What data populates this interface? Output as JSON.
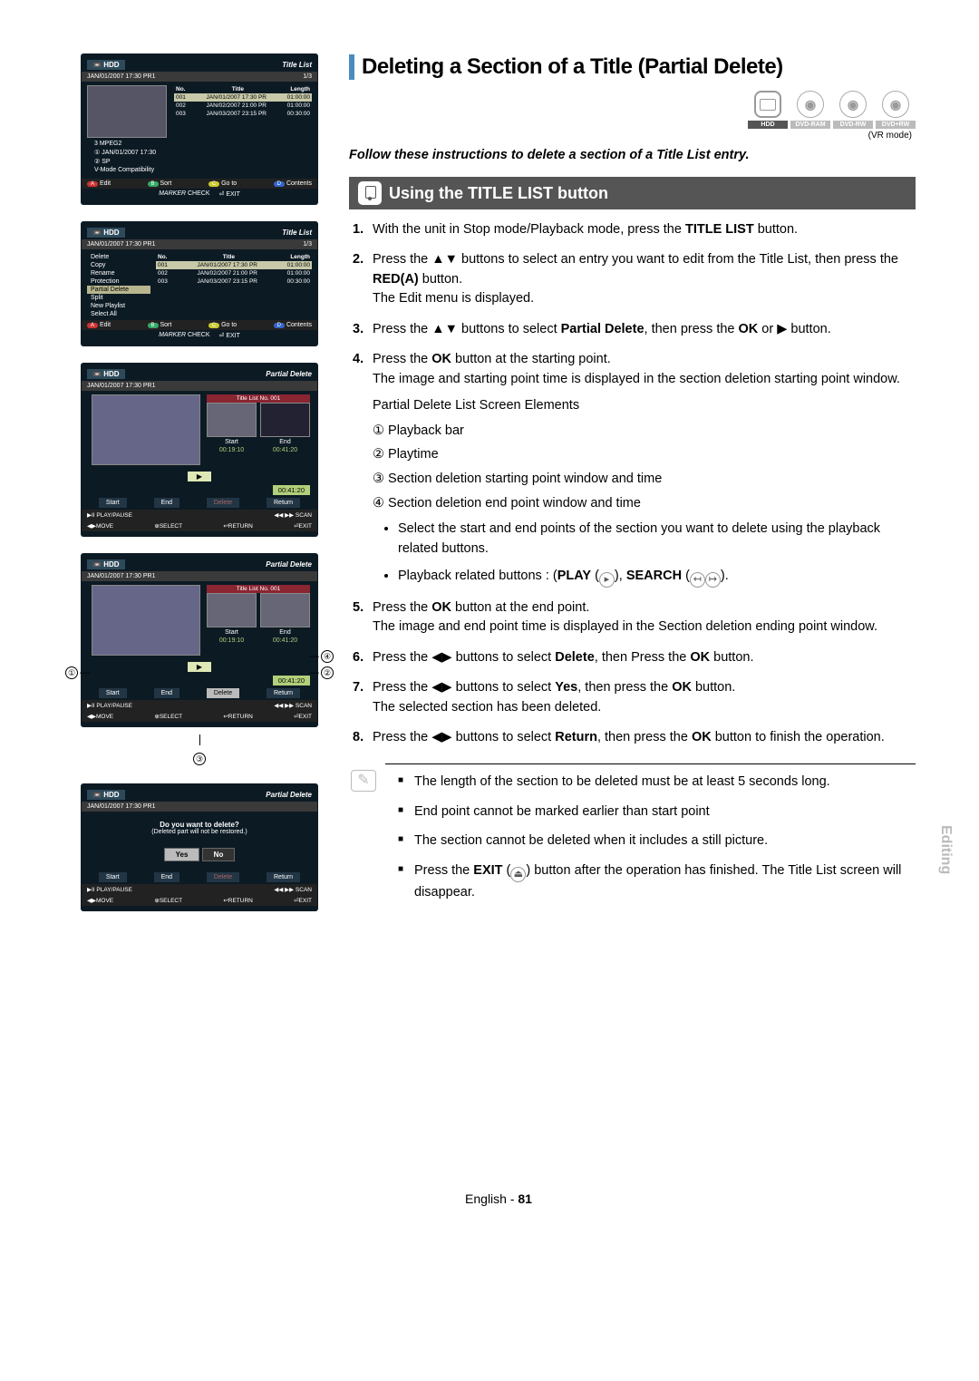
{
  "main": {
    "title": "Deleting a Section of a Title (Partial Delete)",
    "discs": [
      "HDD",
      "DVD-RAM",
      "DVD-RW",
      "DVD+RW"
    ],
    "vr_mode": "(VR mode)",
    "intro": "Follow these instructions to delete a section of a Title List entry.",
    "sub_heading": "Using the TITLE LIST button",
    "steps": {
      "s1_a": "With the unit in Stop mode/Playback mode, press the ",
      "s1_b": "TITLE LIST",
      "s1_c": " button.",
      "s2_a": "Press the ▲▼ buttons to select an entry you want to edit from the Title List, then press the ",
      "s2_b": "RED(A)",
      "s2_c": " button.",
      "s2_d": "The Edit menu is displayed.",
      "s3_a": "Press the ▲▼ buttons to select ",
      "s3_b": "Partial Delete",
      "s3_c": ", then press the ",
      "s3_d": "OK",
      "s3_e": " or ▶ button.",
      "s4_a": "Press the ",
      "s4_b": "OK",
      "s4_c": " button at the starting point.",
      "s4_d": "The image and starting point time is displayed in the section deletion starting point window.",
      "s4_caption": "Partial Delete List Screen Elements",
      "s4_list": {
        "l1": "① Playback bar",
        "l2": "② Playtime",
        "l3": "③ Section deletion starting point window and time",
        "l4": "④ Section deletion end point window and time"
      },
      "s4_bullets": {
        "b1": "Select the start and end points of the section you want to delete using the playback related buttons.",
        "b2_a": "Playback related buttons : (",
        "b2_b": "PLAY",
        "b2_c": "), ",
        "b2_d": "SEARCH",
        "b2_e": ")."
      },
      "s5_a": "Press the ",
      "s5_b": "OK",
      "s5_c": " button at the end point.",
      "s5_d": "The image and end point time is displayed in the Section deletion ending point window.",
      "s6_a": "Press the ◀▶ buttons to select ",
      "s6_b": "Delete",
      "s6_c": ", then Press the ",
      "s6_d": "OK",
      "s6_e": " button.",
      "s7_a": "Press the ◀▶ buttons to select ",
      "s7_b": "Yes",
      "s7_c": ", then press the ",
      "s7_d": "OK",
      "s7_e": " button.",
      "s7_f": "The selected section has been deleted.",
      "s8_a": "Press the ◀▶ buttons to select ",
      "s8_b": "Return",
      "s8_c": ", then press the ",
      "s8_d": "OK",
      "s8_e": " button to finish the operation."
    },
    "notes": {
      "n1": "The length of the section to be deleted must be at least 5 seconds long.",
      "n2": "End point cannot be marked earlier than start point",
      "n3": "The section cannot be deleted when it includes a still picture.",
      "n4_a": "Press the ",
      "n4_b": "EXIT",
      "n4_c": " button after the operation has finished. The Title List screen will disappear."
    }
  },
  "side_label": "Editing",
  "footer": {
    "a": "English - ",
    "b": "81"
  },
  "mocks": {
    "hdd": "HDD",
    "title_list": "Title List",
    "partial_delete": "Partial Delete",
    "date_pr": "JAN/01/2007 17:30 PR1",
    "one_third": "1/3",
    "cols": {
      "no": "No.",
      "title": "Title",
      "length": "Length"
    },
    "rows": [
      {
        "no": "001",
        "t": "JAN/01/2007 17:30 PR",
        "l": "01:00:00"
      },
      {
        "no": "002",
        "t": "JAN/02/2007 21:00 PR",
        "l": "01:00:00"
      },
      {
        "no": "003",
        "t": "JAN/03/2007 23:15 PR",
        "l": "00:30:00"
      }
    ],
    "info": {
      "i1": "3 MPEG2",
      "i2": "① JAN/01/2007 17:30",
      "i3": "② SP",
      "i4": "V-Mode Compatibility"
    },
    "btn": {
      "edit": "Edit",
      "sort": "Sort",
      "goto": "Go to",
      "contents": "Contents",
      "check": "CHECK",
      "exit": "EXIT"
    },
    "btn_prefix": {
      "a": "A",
      "b": "B",
      "c": "C",
      "d": "D",
      "marker": "MARKER",
      "ret": "↩"
    },
    "menu": [
      "Delete",
      "Copy",
      "Rename",
      "Protection",
      "Partial Delete",
      "Split",
      "New Playlist",
      "Select All"
    ],
    "pd": {
      "tl_no": "Title List No. 001",
      "start": "Start",
      "end": "End",
      "t1": "00:19:10",
      "t2": "00:41:20",
      "play": "▶",
      "tb": "00:41:20"
    },
    "ftr_btns": {
      "start": "Start",
      "end": "End",
      "delete": "Delete",
      "return": "Return"
    },
    "nav": {
      "play": "▶II PLAY/PAUSE",
      "scan": "◀◀ ▶▶ SCAN",
      "move": "◀▶MOVE",
      "select": "SELECT",
      "return": "↩RETURN",
      "exit": "EXIT"
    },
    "dialog": {
      "msg": "Do you want to delete?",
      "sub": "(Deleted part will not be restored.)",
      "yes": "Yes",
      "no": "No"
    }
  },
  "annot": {
    "n1": "①",
    "n2": "②",
    "n3": "③",
    "n4": "④"
  }
}
